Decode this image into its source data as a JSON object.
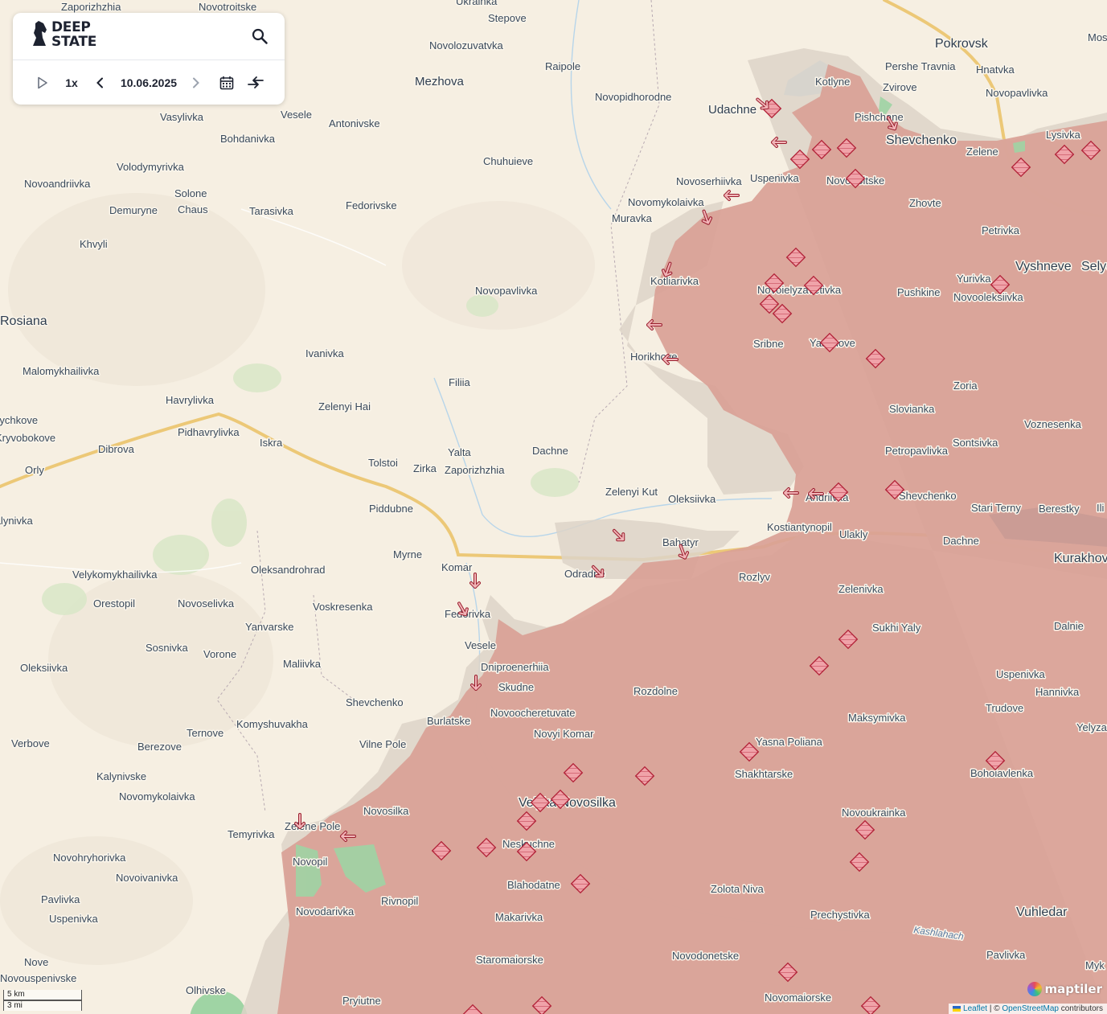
{
  "app": {
    "logo_line1": "DEEP",
    "logo_line2": "STATE"
  },
  "toolbar": {
    "speed": "1x",
    "date": "10.06.2025"
  },
  "icons": {
    "search": "search-icon",
    "play": "play-icon",
    "prev": "chevron-left-icon",
    "next": "chevron-right-icon",
    "calendar": "calendar-icon",
    "compare": "compare-arrows-icon"
  },
  "colors": {
    "occupied": "#d9a196",
    "contested": "#ddd3c8",
    "land": "#f6efe2",
    "road": "#ecc877",
    "water": "#b7d5ea",
    "marker": "#e65b68"
  },
  "scale": {
    "km": "5 km",
    "mi": "3 mi"
  },
  "attribution": {
    "leaflet": "Leaflet",
    "sep": " | © ",
    "osm": "OpenStreetMap",
    "suffix": " contributors"
  },
  "maptiler": "maptiler",
  "places": [
    "Zaporizhzhia",
    "Novotroitske",
    "Ukrainka",
    "Stepove",
    "Pokrovsk",
    "Mos",
    "Novolozuvatvka",
    "Raipole",
    "Pershe Travnia",
    "Hnatvka",
    "Mezhova",
    "Kotlyne",
    "Zvirove",
    "Novopavlivka",
    "Novopidhorodne",
    "Udachne",
    "Pishchane",
    "Vasylivka",
    "Vesele",
    "Antonivske",
    "Bohdanivka",
    "Shevchenko",
    "Lysivka",
    "Zelene",
    "Volodymyrivka",
    "Chuhuieve",
    "Novoserhiivka",
    "Uspenivka",
    "Novotroitske",
    "Novoandriivka",
    "Solone",
    "Chaus",
    "Demuryne",
    "Tarasivka",
    "Fedorivske",
    "Novomykolaivka",
    "Muravka",
    "Zhovte",
    "Petrivka",
    "Khvyli",
    "Vyshneve",
    "Selyd",
    "Kotliarivka",
    "Novoielyzavetivka",
    "Yurivka",
    "Novooleksiivka",
    "Pushkine",
    "Novopavlivka",
    "Rosiana",
    "Sribne",
    "Yasenove",
    "Ivanivka",
    "Horikhove",
    "Malomykhailivka",
    "Filiia",
    "Zoria",
    "Havrylivka",
    "Slovianka",
    "Zelenyi Hai",
    "Voznesenka",
    "Rychkove",
    "Kryvobokove",
    "Pidhavrylivka",
    "Iskra",
    "Sontsivka",
    "Dibrova",
    "Yalta",
    "Dachne",
    "Tolstoi",
    "Zirka",
    "Zaporizhzhia",
    "Petropavlivka",
    "Orly",
    "Zelenyi Kut",
    "Oleksiivka",
    "Andriivka",
    "Shevchenko",
    "Stari Terny",
    "Berestky",
    "Ili",
    "Piddubne",
    "Kostiantynopil",
    "Ulakly",
    "Dachne",
    "Kurakhove",
    "Valynivka",
    "Myrne",
    "Bahatyr",
    "Komar",
    "Oleksandrohrad",
    "Odradne",
    "Rozlyv",
    "Velykomykhailivka",
    "Zelenivka",
    "Orestopil",
    "Novoselivka",
    "Voskresenka",
    "Fedorivka",
    "Sukhi Yaly",
    "Dalnie",
    "Yanvarske",
    "Vesele",
    "Sosnivka",
    "Vorone",
    "Maliivka",
    "Dniproenerhiia",
    "Oleksiivka",
    "Skudne",
    "Uspenivka",
    "Rozdolne",
    "Hannivka",
    "Shevchenko",
    "Novoocheretuvate",
    "Trudove",
    "Maksymivka",
    "Burlatske",
    "Komyshuvakha",
    "Ternove",
    "Novyi Komar",
    "Verbove",
    "Berezove",
    "Vilne Pole",
    "Yasna Poliana",
    "Yelyzavetivka",
    "Shakhtarske",
    "Bohoiavlenka",
    "Kalynivske",
    "Novomykolaivka",
    "Velyka Novosilka",
    "Novosilka",
    "Novoukrainka",
    "Temyrivka",
    "Zelene Pole",
    "Neskuchne",
    "Novohryhorivka",
    "Novopil",
    "Novoivanivka",
    "Blahodatne",
    "Zolota Niva",
    "Pavlivka",
    "Rivnopil",
    "Novodarivka",
    "Prechystivka",
    "Vuhledar",
    "Uspenivka",
    "Makarivka",
    "Kashlahach",
    "Nove",
    "Staromaiorske",
    "Novodonetske",
    "Pavlivka",
    "Myk",
    "Novouspenivske",
    "Olhivske",
    "Novomaiorske",
    "Pryiutne"
  ]
}
